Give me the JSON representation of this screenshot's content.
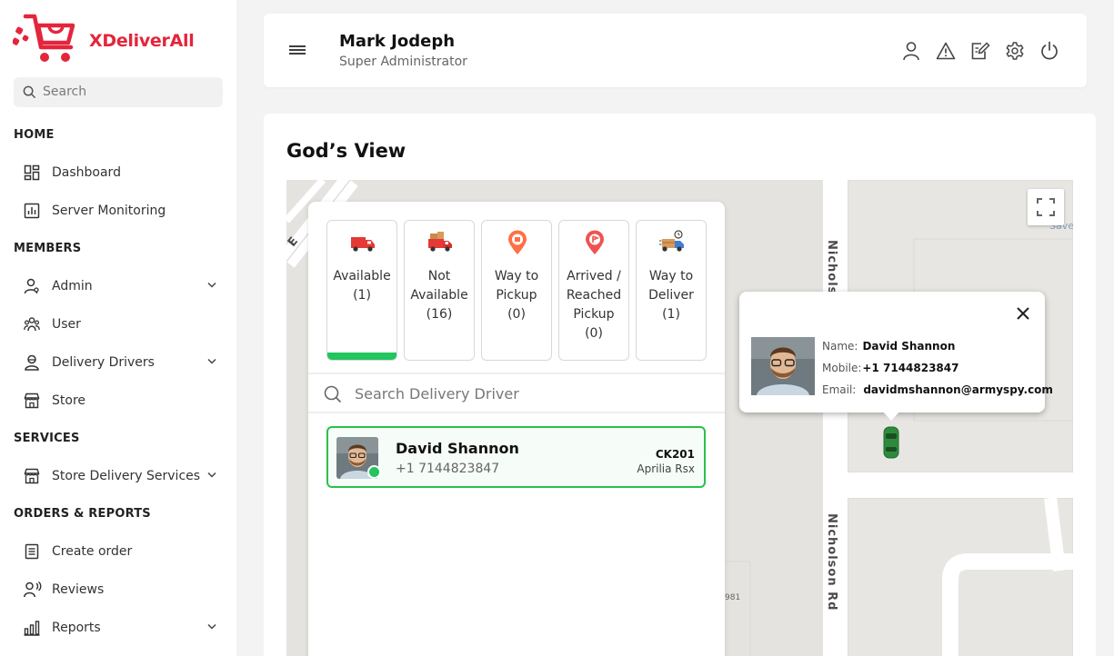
{
  "brand": {
    "name": "XDeliverAll",
    "color": "#e4253c"
  },
  "sidebar": {
    "search_placeholder": "Search",
    "sections": [
      {
        "title": "HOME",
        "items": [
          {
            "label": "Dashboard",
            "icon": "dashboard-icon",
            "expandable": false
          },
          {
            "label": "Server Monitoring",
            "icon": "server-monitoring-icon",
            "expandable": false
          }
        ]
      },
      {
        "title": "MEMBERS",
        "items": [
          {
            "label": "Admin",
            "icon": "admin-icon",
            "expandable": true
          },
          {
            "label": "User",
            "icon": "users-icon",
            "expandable": false
          },
          {
            "label": "Delivery Drivers",
            "icon": "driver-icon",
            "expandable": true
          },
          {
            "label": "Store",
            "icon": "store-icon",
            "expandable": false
          }
        ]
      },
      {
        "title": "SERVICES",
        "items": [
          {
            "label": "Store Delivery Services",
            "icon": "store-icon",
            "expandable": true
          }
        ]
      },
      {
        "title": "ORDERS & REPORTS",
        "items": [
          {
            "label": "Create order",
            "icon": "order-icon",
            "expandable": false
          },
          {
            "label": "Reviews",
            "icon": "reviews-icon",
            "expandable": false
          },
          {
            "label": "Reports",
            "icon": "reports-icon",
            "expandable": true
          }
        ]
      }
    ]
  },
  "header": {
    "user_name": "Mark Jodeph",
    "user_role": "Super Administrator",
    "icons": [
      "user-icon",
      "alert-icon",
      "edit-icon",
      "settings-icon",
      "power-icon"
    ]
  },
  "main": {
    "title": "God’s View",
    "status_tabs": [
      {
        "label_lines": [
          "Available",
          "(1)"
        ],
        "icon": "truck-icon",
        "active": true
      },
      {
        "label_lines": [
          "Not",
          "Available",
          "(16)"
        ],
        "icon": "loaded-truck-icon",
        "active": false
      },
      {
        "label_lines": [
          "Way to",
          "Pickup",
          "(0)"
        ],
        "icon": "pickup-pin-icon",
        "active": false
      },
      {
        "label_lines": [
          "Arrived /",
          "Reached",
          "Pickup",
          "(0)"
        ],
        "icon": "arrived-pin-icon",
        "active": false
      },
      {
        "label_lines": [
          "Way to",
          "Deliver",
          "(1)"
        ],
        "icon": "deliver-truck-icon",
        "active": false
      }
    ],
    "driver_search_placeholder": "Search Delivery Driver",
    "drivers": [
      {
        "name": "David Shannon",
        "phone": "+1 7144823847",
        "code": "CK201",
        "vehicle": "Aprilia Rsx",
        "online": true
      }
    ],
    "popup": {
      "name_label": "Name:",
      "name": "David Shannon",
      "mobile_label": "Mobile:",
      "mobile": "+1 7144823847",
      "email_label": "Email:",
      "email": "davidmshannon@armyspy.com"
    },
    "map_labels": {
      "road_1": "Nicholson Rd",
      "road_1_partial": "Nicholso",
      "edge_label": "E",
      "poi_partial": "Save",
      "number_partial": "981"
    }
  },
  "colors": {
    "active": "#22c55e",
    "accent": "#e4253c"
  }
}
